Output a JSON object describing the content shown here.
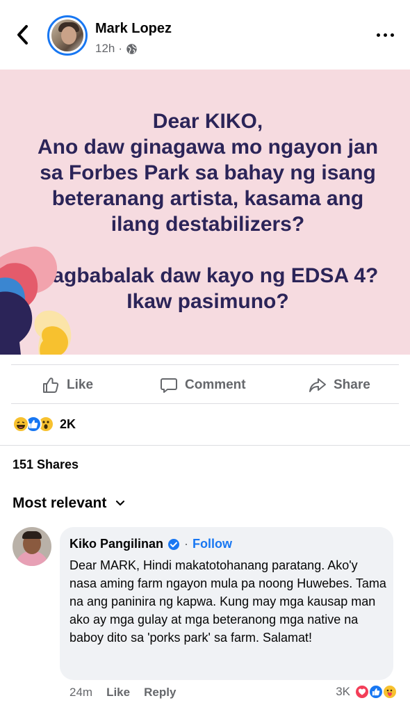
{
  "header": {
    "author": "Mark Lopez",
    "time": "12h",
    "separator": "·",
    "audience_icon": "globe-icon",
    "back_icon": "chevron-left-icon",
    "more_icon": "more-horizontal-icon"
  },
  "post": {
    "background": "#f6dbe0",
    "text_color": "#2b2458",
    "lines_1": [
      "Dear KIKO,",
      "Ano daw ginagawa mo ngayon jan",
      "sa Forbes Park sa bahay ng isang",
      "beteranang artista, kasama ang",
      "ilang destabilizers?"
    ],
    "lines_2": [
      "Nagbabalak daw kayo ng EDSA 4?",
      "Ikaw pasimuno?"
    ]
  },
  "actions": {
    "like": "Like",
    "comment": "Comment",
    "share": "Share"
  },
  "reactions": {
    "icons": [
      "haha-icon",
      "like-icon",
      "wow-icon"
    ],
    "count": "2K"
  },
  "shares_text": "151 Shares",
  "sort": {
    "label": "Most relevant",
    "icon": "chevron-down-icon"
  },
  "comment": {
    "author": "Kiko Pangilinan",
    "verified_icon": "verified-badge-icon",
    "separator": "·",
    "follow": "Follow",
    "text": "Dear MARK, Hindi makatotohanang paratang. Ako'y nasa aming farm ngayon mula pa noong Huwebes. Tama na ang paninira ng kapwa. Kung may mga kausap man ako ay mga gulay at mga beteranong mga native na baboy dito sa 'porks park' sa farm. Salamat!",
    "time": "24m",
    "like": "Like",
    "reply": "Reply",
    "reaction_count": "3K",
    "reaction_icons": [
      "love-icon",
      "like-icon",
      "care-icon"
    ]
  },
  "colors": {
    "accent": "#1877f2",
    "muted": "#65676b"
  }
}
